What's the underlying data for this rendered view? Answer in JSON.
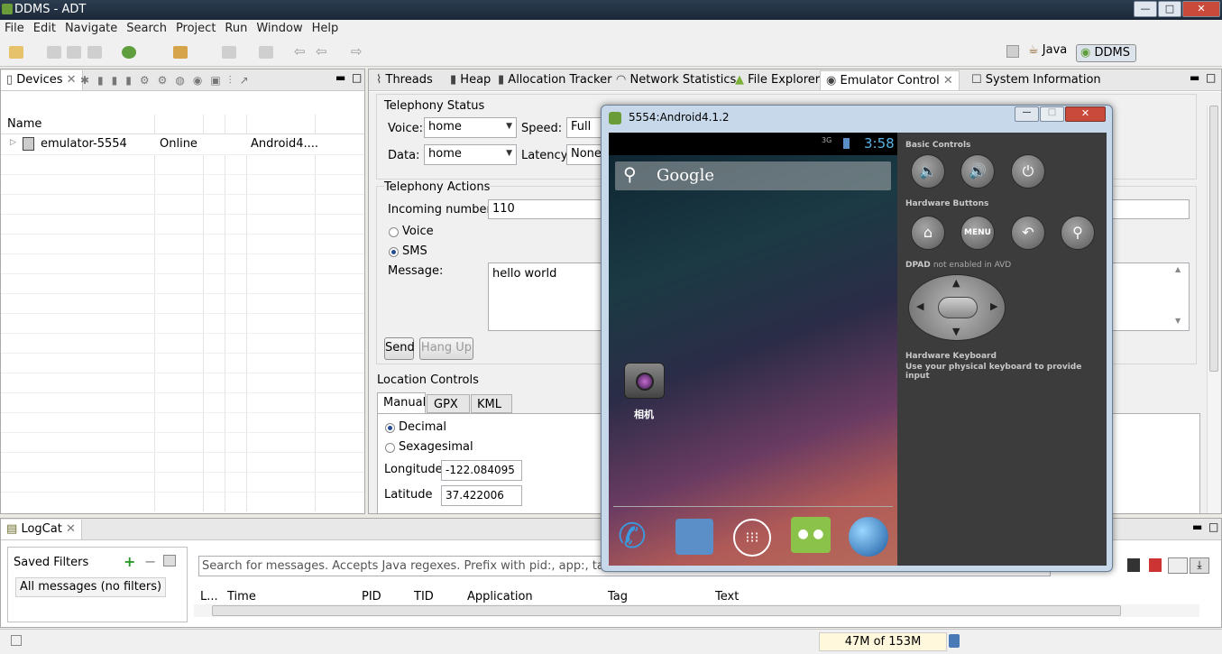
{
  "window": {
    "title": "DDMS - ADT",
    "minimize": "—",
    "maximize": "□",
    "close": "✕"
  },
  "menu": [
    "File",
    "Edit",
    "Navigate",
    "Search",
    "Project",
    "Run",
    "Window",
    "Help"
  ],
  "perspectives": {
    "java": "Java",
    "ddms": "DDMS"
  },
  "devices": {
    "tab": "Devices",
    "col_name": "Name",
    "rows": [
      {
        "name": "emulator-5554",
        "state": "Online",
        "target": "Android4...."
      }
    ]
  },
  "tabs": [
    "Threads",
    "Heap",
    "Allocation Tracker",
    "Network Statistics",
    "File Explorer",
    "Emulator Control",
    "System Information"
  ],
  "telephony_status": {
    "title": "Telephony Status",
    "voice_label": "Voice:",
    "voice_value": "home",
    "speed_label": "Speed:",
    "speed_value": "Full",
    "data_label": "Data:",
    "data_value": "home",
    "latency_label": "Latency:",
    "latency_value": "None"
  },
  "telephony_actions": {
    "title": "Telephony Actions",
    "incoming_label": "Incoming number:",
    "incoming_value": "110",
    "voice": "Voice",
    "sms": "SMS",
    "message_label": "Message:",
    "message_value": "hello world",
    "send": "Send",
    "hangup": "Hang Up"
  },
  "location": {
    "title": "Location Controls",
    "tabs": [
      "Manual",
      "GPX",
      "KML"
    ],
    "decimal": "Decimal",
    "sexagesimal": "Sexagesimal",
    "longitude_label": "Longitude",
    "longitude_value": "-122.084095",
    "latitude_label": "Latitude",
    "latitude_value": "37.422006"
  },
  "emulator": {
    "title": "5554:Android4.1.2",
    "clock": "3:58",
    "signal": "3G",
    "search_text": "Google",
    "camera_label": "相机",
    "basic_controls": "Basic Controls",
    "hardware_buttons": "Hardware Buttons",
    "menu_btn": "MENU",
    "dpad_title": "DPAD",
    "dpad_note": "not enabled in AVD",
    "keyboard_title": "Hardware Keyboard",
    "keyboard_note": "Use your physical keyboard to provide input"
  },
  "logcat": {
    "tab": "LogCat",
    "saved_filters": "Saved Filters",
    "all_messages": "All messages (no filters)",
    "search_placeholder": "Search for messages. Accepts Java regexes. Prefix with pid:, app:, tag: or text:",
    "columns": [
      "L...",
      "Time",
      "PID",
      "TID",
      "Application",
      "Tag",
      "Text"
    ]
  },
  "status": {
    "memory": "47M of 153M"
  }
}
